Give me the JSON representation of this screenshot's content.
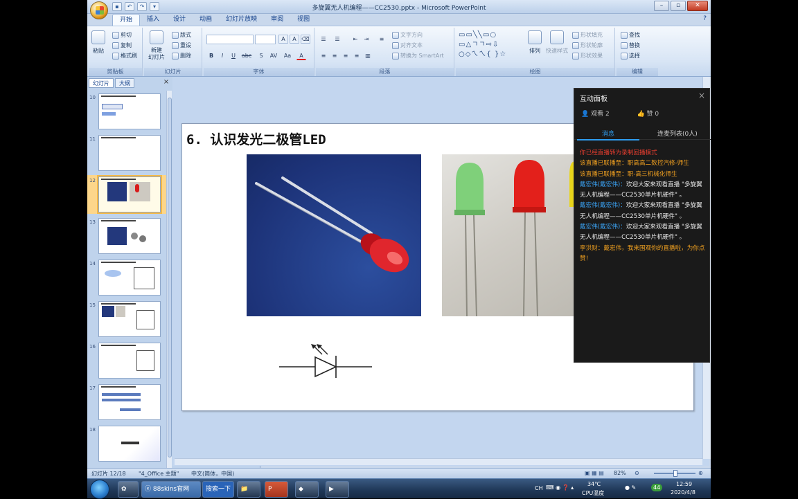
{
  "window": {
    "title": "多旋翼无人机编程——CC2530.pptx - Microsoft PowerPoint"
  },
  "tabs": [
    "开始",
    "插入",
    "设计",
    "动画",
    "幻灯片放映",
    "审阅",
    "视图"
  ],
  "ribbon": {
    "clipboard": {
      "paste": "粘贴",
      "cut": "剪切",
      "copy": "复制",
      "format_painter": "格式刷",
      "label": "剪贴板"
    },
    "slides": {
      "new_slide": "新建\n幻灯片",
      "layout": "版式",
      "reset": "重设",
      "delete": "删除",
      "label": "幻灯片"
    },
    "font": {
      "label": "字体",
      "bold": "B",
      "italic": "I",
      "underline": "U",
      "strike": "abc",
      "shadow": "S",
      "spacing": "AV",
      "case": "Aa",
      "color": "A"
    },
    "paragraph": {
      "text_direction": "文字方向",
      "align_text": "对齐文本",
      "smartart": "转换为 SmartArt",
      "label": "段落"
    },
    "drawing": {
      "arrange": "排列",
      "quick_styles": "快速样式",
      "fill": "形状填充",
      "outline": "形状轮廓",
      "effects": "形状效果",
      "label": "绘图"
    },
    "editing": {
      "find": "查找",
      "replace": "替换",
      "select": "选择",
      "label": "编辑"
    }
  },
  "pane": {
    "tab_slides": "幻灯片",
    "tab_outline": "大纲",
    "close": "×",
    "thumbs": [
      {
        "num": "10"
      },
      {
        "num": "11"
      },
      {
        "num": "12"
      },
      {
        "num": "13"
      },
      {
        "num": "14"
      },
      {
        "num": "15"
      },
      {
        "num": "16"
      },
      {
        "num": "17"
      },
      {
        "num": "18"
      }
    ]
  },
  "slide": {
    "title": "6. 认识发光二极管LED"
  },
  "status": {
    "slide_num": "幻灯片 12/18",
    "theme": "\"4_Office 主题\"",
    "lang": "中文(简体，中国)",
    "zoom": "82%",
    "zoom_level": 0.82
  },
  "taskbar": {
    "browser": "88skins官网",
    "search": "搜索一下",
    "temp": "34℃",
    "cpu": "CPU温度",
    "time": "12:59",
    "date": "2020/4/8",
    "lang": "CH",
    "badge": "44"
  },
  "panel": {
    "title": "互动面板",
    "close": "×",
    "viewers": "观看 2",
    "likes": "赞 0",
    "tab_messages": "消息",
    "tab_mic": "连麦列表(0人)",
    "messages": [
      {
        "text": "你已经直播转为录制回播模式",
        "color": "red"
      },
      {
        "text": "该直播已联播至：职高高二数控汽修-师生",
        "color": "orange"
      },
      {
        "text": "该直播已联播至：职-高三机械化师生",
        "color": "orange"
      },
      {
        "name": "戴宏伟(戴宏伟)：",
        "text": "欢迎大家来观看直播 \"多旋翼无人机编程——CC2530单片机硬件\" 。",
        "color": "blue"
      },
      {
        "name": "戴宏伟(戴宏伟)：",
        "text": "欢迎大家来观看直播 \"多旋翼无人机编程——CC2530单片机硬件\" 。",
        "color": "blue"
      },
      {
        "name": "戴宏伟(戴宏伟)：",
        "text": "欢迎大家来观看直播 \"多旋翼无人机编程——CC2530单片机硬件\" 。",
        "color": "blue"
      },
      {
        "text": "李洪财：戴宏伟，我来围观你的直播啦，为你点赞！",
        "color": "orange"
      }
    ]
  },
  "colors": {
    "ribbon": "#dbe7f6",
    "pane": "#bfd3ec",
    "panel_bg": "#1a1a1a",
    "accent": "#2e9df0"
  }
}
